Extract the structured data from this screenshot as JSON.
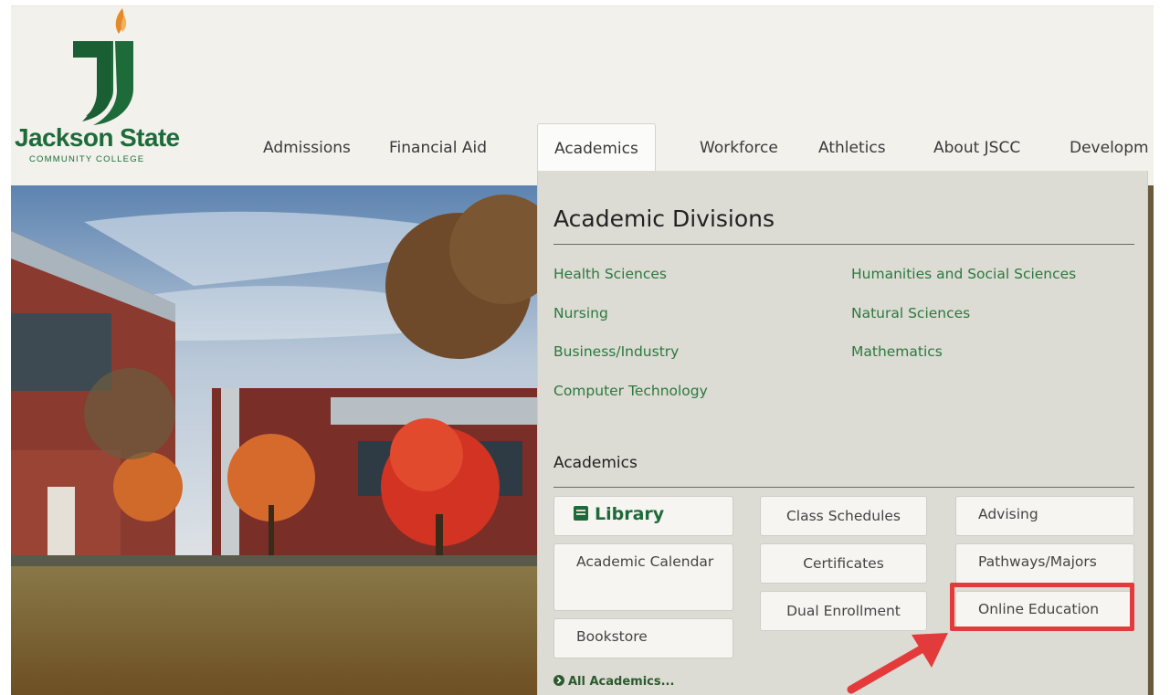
{
  "brand": {
    "name": "Jackson State",
    "subtitle": "COMMUNITY COLLEGE",
    "colors": {
      "green": "#1e6b3a",
      "flame": "#e58a2a",
      "link": "#2b7a3d"
    }
  },
  "nav": {
    "items": [
      {
        "label": "Admissions"
      },
      {
        "label": "Financial Aid"
      },
      {
        "label": "Academics",
        "active": true
      },
      {
        "label": "Workforce"
      },
      {
        "label": "Athletics"
      },
      {
        "label": "About JSCC"
      },
      {
        "label": "Developm"
      }
    ]
  },
  "dropdown": {
    "heading": "Academic Divisions",
    "divisions_left": [
      "Health Sciences",
      "Nursing",
      "Business/Industry",
      "Computer Technology"
    ],
    "divisions_right": [
      "Humanities and Social Sciences",
      "Natural Sciences",
      "Mathematics"
    ],
    "academics_heading": "Academics",
    "buttons": {
      "library": "Library",
      "academic_calendar": "Academic Calendar",
      "bookstore": "Bookstore",
      "class_schedules": "Class Schedules",
      "certificates": "Certificates",
      "dual_enrollment": "Dual Enrollment",
      "advising": "Advising",
      "pathways_majors": "Pathways/Majors",
      "online_education": "Online Education"
    },
    "all_link": "All Academics...",
    "icons": {
      "library": "book-icon",
      "all_link": "circle-chevron-right-icon"
    }
  },
  "annotation": {
    "highlight_color": "#e33b3b",
    "highlighted_item": "Online Education"
  }
}
